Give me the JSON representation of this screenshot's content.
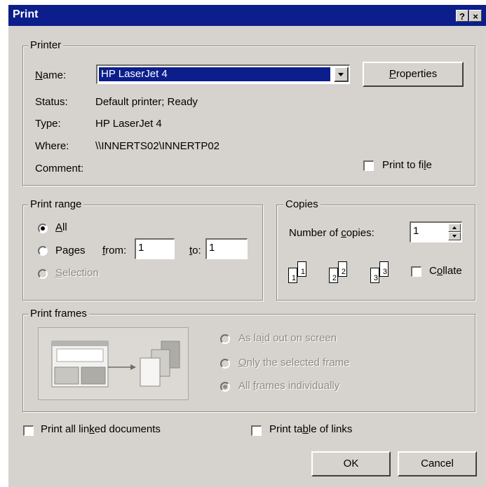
{
  "window": {
    "title": "Print",
    "help_button": "?",
    "close_button": "×"
  },
  "printer": {
    "group_label": "Printer",
    "name_label": "Name:",
    "name_value": "HP LaserJet 4",
    "properties_button": "Properties",
    "status_label": "Status:",
    "status_value": "Default printer; Ready",
    "type_label": "Type:",
    "type_value": "HP LaserJet 4",
    "where_label": "Where:",
    "where_value": "\\\\INNERTS02\\INNERTP02",
    "comment_label": "Comment:",
    "print_to_file_label": "Print to file",
    "print_to_file_checked": false
  },
  "print_range": {
    "group_label": "Print range",
    "all_label": "All",
    "pages_label": "Pages",
    "from_label": "from:",
    "from_value": "1",
    "to_label": "to:",
    "to_value": "1",
    "selection_label": "Selection",
    "selected": "All"
  },
  "copies": {
    "group_label": "Copies",
    "number_label": "Number of copies:",
    "number_value": "1",
    "collate_label": "Collate",
    "collate_checked": false,
    "page_numbers": [
      "1",
      "1",
      "2",
      "2",
      "3",
      "3"
    ]
  },
  "print_frames": {
    "group_label": "Print frames",
    "option_layout": "As laid out on screen",
    "option_selected_frame": "Only the selected frame",
    "option_individually": "All frames individually",
    "selected": "All frames individually"
  },
  "options": {
    "linked_docs_label": "Print all linked documents",
    "table_of_links_label": "Print table of links"
  },
  "buttons": {
    "ok": "OK",
    "cancel": "Cancel"
  }
}
